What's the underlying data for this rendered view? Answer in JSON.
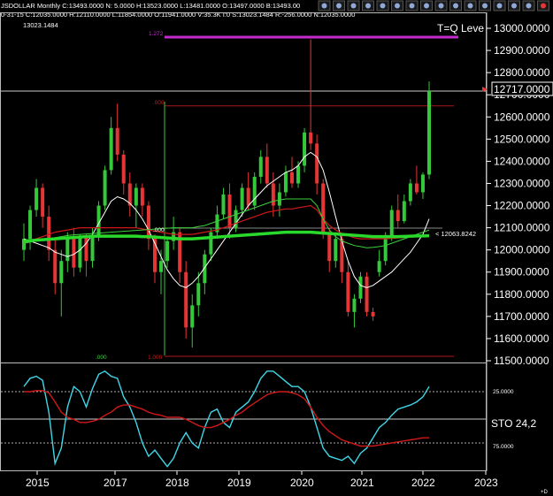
{
  "header": {
    "symbol_line": "JSDOLLAR Monthly C:13493.0000 N: 5.0000 H:13523.0000 L:13481.0000 O:13497.0000 B:13493.00",
    "sub_line": "0-31-15 C:12035.0000 H:12110.0000 L:11854.0000 O:11941.0000 V:35.3K I:0 S:13023.1484 R:-256.0000 N:12035.0000",
    "third_line": "13023.1484"
  },
  "toolbar": {
    "icons": [
      "bell-icon",
      "wave-icon",
      "bars-icon",
      "dots-icon",
      "list-icon",
      "alarm-icon",
      "pen-icon",
      "ruler-icon",
      "square-icon",
      "line-icon",
      "plus-icon",
      "hand-icon",
      "triangle-icon",
      "scale-icon",
      "lines-icon",
      "close-icon"
    ]
  },
  "annotations": {
    "level_1272": "1.272",
    "level_000_top": ".000",
    "level_000_mid": ".000",
    "level_000_bottom": ".000",
    "level_1000": "1.000",
    "tq_label": "T=Q Leve",
    "ma_value": "< 12063.8242",
    "current_price": "12717.0000",
    "sto_label": "STO 24,2",
    "sto_25": "25.0000",
    "sto_75": "75.0000",
    "corner": "+D"
  },
  "colors": {
    "up": "#35c83a",
    "down": "#e63535",
    "ma_white": "#ffffff",
    "ma_red": "#d11818",
    "ma_green_thin": "#3bd13b",
    "ma_green_thick": "#29d92b",
    "stoch": "#3fd6e8",
    "stoch_signal": "#d11818",
    "fib_magenta": "#c32bcf"
  },
  "chart_data": [
    {
      "type": "candlestick",
      "title": "",
      "x_ticks": [
        "2015",
        "2017",
        "2018",
        "2019",
        "2020",
        "2021",
        "2022",
        "2023"
      ],
      "y_ticks": [
        "13000.0000",
        "12900.0000",
        "12800.0000",
        "12700.0000",
        "12600.0000",
        "12500.0000",
        "12400.0000",
        "12300.0000",
        "12200.0000",
        "12100.0000",
        "12000.0000",
        "11900.0000",
        "11800.0000",
        "11700.0000",
        "11600.0000",
        "11500.0000"
      ],
      "ylim": [
        11500,
        13000
      ],
      "candles_ohlc": [
        [
          12000,
          12120,
          11950,
          12050
        ],
        [
          12050,
          12200,
          12000,
          12180
        ],
        [
          12180,
          12320,
          12150,
          12280
        ],
        [
          12280,
          12300,
          12100,
          12150
        ],
        [
          12150,
          12200,
          11950,
          12000
        ],
        [
          12000,
          12050,
          11800,
          11850
        ],
        [
          11850,
          12000,
          11700,
          11950
        ],
        [
          11950,
          12080,
          11900,
          12050
        ],
        [
          12050,
          12100,
          11880,
          11920
        ],
        [
          11920,
          12070,
          11900,
          12060
        ],
        [
          12060,
          12070,
          11880,
          11950
        ],
        [
          11950,
          12100,
          11920,
          12060
        ],
        [
          12060,
          12220,
          12040,
          12200
        ],
        [
          12200,
          12380,
          12180,
          12360
        ],
        [
          12360,
          12600,
          12340,
          12550
        ],
        [
          12550,
          12660,
          12400,
          12430
        ],
        [
          12430,
          12450,
          12250,
          12300
        ],
        [
          12300,
          12350,
          12150,
          12200
        ],
        [
          12200,
          12300,
          12100,
          12280
        ],
        [
          12280,
          12300,
          12150,
          12200
        ],
        [
          12200,
          12220,
          12000,
          12050
        ],
        [
          12050,
          12070,
          11850,
          11900
        ],
        [
          11900,
          12000,
          11800,
          11950
        ],
        [
          11950,
          12050,
          11920,
          12040
        ],
        [
          12040,
          12150,
          12000,
          12080
        ],
        [
          12080,
          12100,
          11850,
          11900
        ],
        [
          11900,
          11950,
          11600,
          11650
        ],
        [
          11650,
          11800,
          11560,
          11750
        ],
        [
          11750,
          11900,
          11700,
          11850
        ],
        [
          11850,
          12000,
          11800,
          11980
        ],
        [
          11980,
          12100,
          11950,
          12080
        ],
        [
          12080,
          12200,
          12050,
          12160
        ],
        [
          12160,
          12280,
          12140,
          12250
        ],
        [
          12250,
          12300,
          12050,
          12100
        ],
        [
          12100,
          12200,
          12080,
          12180
        ],
        [
          12180,
          12300,
          12150,
          12280
        ],
        [
          12280,
          12350,
          12180,
          12200
        ],
        [
          12200,
          12350,
          12180,
          12330
        ],
        [
          12330,
          12450,
          12300,
          12420
        ],
        [
          12420,
          12480,
          12280,
          12300
        ],
        [
          12300,
          12350,
          12150,
          12200
        ],
        [
          12200,
          12300,
          12150,
          12260
        ],
        [
          12260,
          12380,
          12240,
          12350
        ],
        [
          12350,
          12420,
          12280,
          12300
        ],
        [
          12300,
          12400,
          12280,
          12380
        ],
        [
          12380,
          12550,
          12350,
          12530
        ],
        [
          12530,
          12950,
          12450,
          12480
        ],
        [
          12480,
          12520,
          12250,
          12300
        ],
        [
          12300,
          12320,
          12050,
          12080
        ],
        [
          12080,
          12100,
          11900,
          11950
        ],
        [
          11950,
          12080,
          11920,
          12050
        ],
        [
          12050,
          12070,
          11850,
          11900
        ],
        [
          11900,
          11950,
          11700,
          11720
        ],
        [
          11720,
          11800,
          11650,
          11780
        ],
        [
          11780,
          11900,
          11760,
          11880
        ],
        [
          11880,
          11900,
          11700,
          11720
        ],
        [
          11720,
          11740,
          11680,
          11700
        ],
        [
          11900,
          12000,
          11880,
          11950
        ],
        [
          11950,
          12080,
          11930,
          12060
        ],
        [
          12060,
          12200,
          12040,
          12180
        ],
        [
          12180,
          12250,
          12100,
          12130
        ],
        [
          12130,
          12250,
          12120,
          12220
        ],
        [
          12220,
          12320,
          12200,
          12300
        ],
        [
          12300,
          12380,
          12250,
          12260
        ],
        [
          12260,
          12350,
          12230,
          12340
        ],
        [
          12340,
          12760,
          12320,
          12717
        ]
      ],
      "moving_averages": [
        {
          "name": "white",
          "values": [
            12050,
            12040,
            12030,
            12020,
            12010,
            11990,
            11980,
            11970,
            11980,
            12000,
            12030,
            12070,
            12120,
            12170,
            12220,
            12240,
            12230,
            12210,
            12180,
            12140,
            12090,
            12030,
            11970,
            11910,
            11870,
            11840,
            11830,
            11850,
            11880,
            11920,
            11960,
            12000,
            12040,
            12080,
            12120,
            12160,
            12200,
            12230,
            12260,
            12290,
            12310,
            12330,
            12350,
            12360,
            12380,
            12420,
            12440,
            12420,
            12360,
            12260,
            12150,
            12040,
            11950,
            11880,
            11840,
            11830,
            11840,
            11860,
            11880,
            11900,
            11930,
            11960,
            11990,
            12030,
            12070,
            12140
          ]
        },
        {
          "name": "red",
          "values": [
            12030,
            12040,
            12050,
            12060,
            12070,
            12080,
            12085,
            12090,
            12095,
            12100,
            12100,
            12100,
            12100,
            12100,
            12100,
            12100,
            12100,
            12100,
            12100,
            12095,
            12090,
            12085,
            12080,
            12075,
            12070,
            12070,
            12070,
            12070,
            12075,
            12080,
            12085,
            12090,
            12100,
            12110,
            12120,
            12130,
            12140,
            12150,
            12160,
            12170,
            12175,
            12180,
            12185,
            12185,
            12190,
            12195,
            12200,
            12180,
            12140,
            12110,
            12090,
            12075,
            12065,
            12055,
            12050,
            12050,
            12050,
            12050,
            12050,
            12052,
            12054,
            12056,
            12058,
            12060,
            12062,
            12064
          ]
        },
        {
          "name": "green_thin",
          "values": [
            12030,
            12035,
            12040,
            12045,
            12050,
            12055,
            12060,
            12065,
            12068,
            12070,
            12072,
            12074,
            12076,
            12078,
            12080,
            12082,
            12084,
            12086,
            12088,
            12090,
            12092,
            12094,
            12096,
            12098,
            12100,
            12100,
            12100,
            12100,
            12105,
            12110,
            12120,
            12130,
            12140,
            12150,
            12160,
            12170,
            12180,
            12190,
            12200,
            12210,
            12220,
            12225,
            12230,
            12230,
            12230,
            12230,
            12230,
            12200,
            12140,
            12090,
            12060,
            12040,
            12030,
            12020,
            12015,
            12010,
            12012,
            12015,
            12020,
            12030,
            12040,
            12050,
            12060,
            12070,
            12080,
            12090
          ]
        },
        {
          "name": "green_thick",
          "values": [
            12040,
            12042,
            12044,
            12046,
            12048,
            12050,
            12052,
            12054,
            12056,
            12058,
            12060,
            12062,
            12062,
            12062,
            12062,
            12062,
            12062,
            12062,
            12062,
            12060,
            12060,
            12058,
            12056,
            12054,
            12052,
            12050,
            12050,
            12050,
            12052,
            12054,
            12056,
            12058,
            12060,
            12062,
            12064,
            12066,
            12068,
            12070,
            12072,
            12074,
            12076,
            12078,
            12080,
            12080,
            12080,
            12080,
            12080,
            12078,
            12076,
            12074,
            12072,
            12070,
            12068,
            12066,
            12064,
            12062,
            12060,
            12060,
            12060,
            12060,
            12060,
            12061,
            12062,
            12063,
            12063,
            12064
          ]
        }
      ],
      "fib_levels": [
        {
          "label": "1.272",
          "value": 12960
        },
        {
          "label": ".000",
          "value": 12650
        },
        {
          "label": "1.000",
          "value": 11520
        }
      ],
      "horizontal_line": 12717
    },
    {
      "type": "line",
      "title": "STO 24,2",
      "ylim": [
        100,
        0
      ],
      "series": [
        {
          "name": "STO",
          "values": [
            20,
            12,
            10,
            14,
            45,
            95,
            80,
            40,
            20,
            25,
            40,
            22,
            8,
            5,
            10,
            12,
            30,
            40,
            55,
            75,
            88,
            82,
            90,
            98,
            90,
            75,
            65,
            75,
            80,
            60,
            45,
            42,
            55,
            60,
            45,
            40,
            35,
            25,
            12,
            5,
            5,
            10,
            15,
            20,
            20,
            25,
            40,
            60,
            80,
            88,
            90,
            92,
            88,
            95,
            85,
            80,
            70,
            60,
            55,
            48,
            42,
            40,
            38,
            35,
            30,
            20
          ]
        },
        {
          "name": "signal",
          "values": [
            25,
            25,
            24,
            24,
            26,
            35,
            45,
            50,
            52,
            55,
            55,
            54,
            52,
            48,
            45,
            40,
            38,
            38,
            40,
            42,
            45,
            47,
            48,
            50,
            50,
            50,
            52,
            55,
            58,
            60,
            60,
            58,
            55,
            52,
            48,
            45,
            40,
            36,
            32,
            28,
            26,
            25,
            25,
            26,
            28,
            32,
            40,
            50,
            58,
            64,
            68,
            72,
            74,
            76,
            78,
            78,
            78,
            77,
            76,
            75,
            74,
            73,
            72,
            71,
            70,
            70
          ]
        }
      ],
      "levels": [
        25,
        75
      ]
    }
  ]
}
